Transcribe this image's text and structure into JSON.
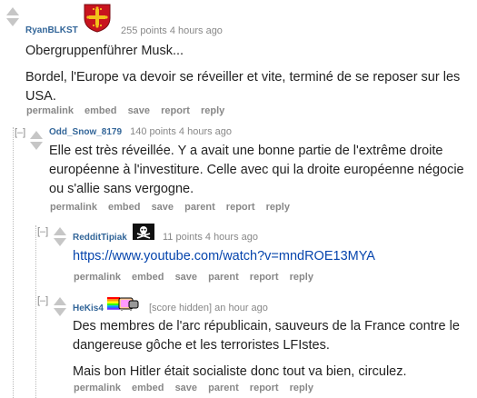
{
  "comments": [
    {
      "author": "RyanBLKST",
      "score": "255 points",
      "time": "4 hours ago",
      "flair_icon": "occitan-cross-shield-icon",
      "paragraphs": [
        "Obergruppenführer Musk...",
        "Bordel, l'Europe va devoir se réveiller et vite, terminé de se reposer sur les USA."
      ],
      "buttons": [
        "permalink",
        "embed",
        "save",
        "report",
        "reply"
      ]
    },
    {
      "author": "Odd_Snow_8179",
      "collapse": "[–]",
      "score": "140 points",
      "time": "4 hours ago",
      "paragraphs": [
        "Elle est très réveillée. Y a avait une bonne partie de l'extrême droite européenne à l'investiture. Celle avec qui la droite européenne négocie ou s'allie sans vergogne."
      ],
      "buttons": [
        "permalink",
        "embed",
        "save",
        "parent",
        "report",
        "reply"
      ]
    },
    {
      "author": "RedditTipiak",
      "collapse": "[–]",
      "score": "11 points",
      "time": "4 hours ago",
      "flair_icon": "jolly-roger-icon",
      "link": "https://www.youtube.com/watch?v=mndROE13MYA",
      "buttons": [
        "permalink",
        "embed",
        "save",
        "parent",
        "report",
        "reply"
      ]
    },
    {
      "author": "HeKis4",
      "collapse": "[–]",
      "score": "[score hidden]",
      "time": "an hour ago",
      "flair_icon": "nyan-cat-icon",
      "paragraphs": [
        "Des membres de l'arc républicain, sauveurs de la France contre le dangereuse gôche et les terroristes LFIstes.",
        "Mais bon Hitler était socialiste donc tout va bien, circulez."
      ],
      "buttons": [
        "permalink",
        "embed",
        "save",
        "parent",
        "report",
        "reply"
      ]
    }
  ]
}
